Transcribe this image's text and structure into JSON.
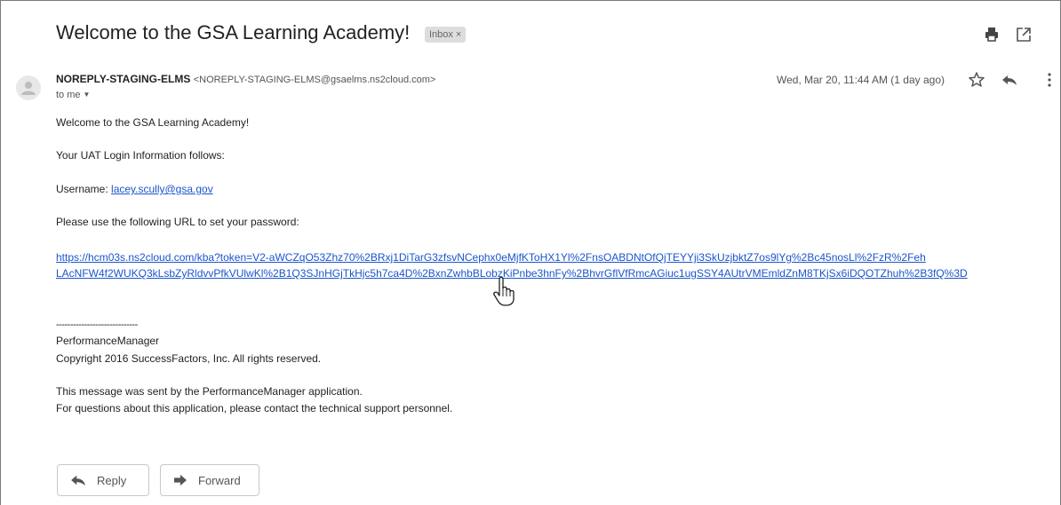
{
  "email": {
    "subject": "Welcome to the GSA Learning Academy!",
    "label": "Inbox",
    "label_close": "×",
    "sender_name": "NOREPLY-STAGING-ELMS",
    "sender_address": "<NOREPLY-STAGING-ELMS@gsaelms.ns2cloud.com>",
    "recipient": "to me",
    "date": "Wed, Mar 20, 11:44 AM (1 day ago)"
  },
  "body": {
    "greeting": "Welcome to the GSA Learning Academy!",
    "login_info": "Your UAT Login Information follows:",
    "username_label": "Username: ",
    "username_value": "lacey.scully@gsa.gov",
    "password_instruction": "Please use the following URL to set your password:",
    "url_line1": "https://hcm03s.ns2cloud.com/kba?token=V2-aWCZqO53Zhz70%2BRxj1DiTarG3zfsvNCephx0eMjfKToHX1Yl%2FnsOABDNtOfQjTEYYji3SkUzjbktZ7os9lYg%2Bc45nosLl%2FzR%2Feh",
    "url_line2": "LAcNFW4f2WUKQ3kLsbZyRldvvPfkVUlwKl%2B1Q3SJnHGjTkHjc5h7ca4D%2BxnZwhbBLobzKiPnbe3hnFy%2BhvrGflVfRmcAGiuc1ugSSY4AUtrVMEmldZnM8TKjSx6iDQOTZhuh%2B3fQ%3D",
    "separator": "-----------------------------",
    "product": "PerformanceManager",
    "copyright": "Copyright 2016 SuccessFactors, Inc. All rights reserved.",
    "sent_by": "This message was sent by the PerformanceManager application.",
    "support": "For questions about this application, please contact the technical support personnel."
  },
  "actions": {
    "reply_label": "Reply",
    "forward_label": "Forward"
  },
  "icons": [
    "print-icon",
    "new-window-icon",
    "avatar-icon",
    "star-icon",
    "reply-icon",
    "more-vert-icon",
    "hand-cursor-icon"
  ],
  "colors": {
    "link": "#1a55cc",
    "chip": "#dddddd",
    "text": "#222222"
  }
}
